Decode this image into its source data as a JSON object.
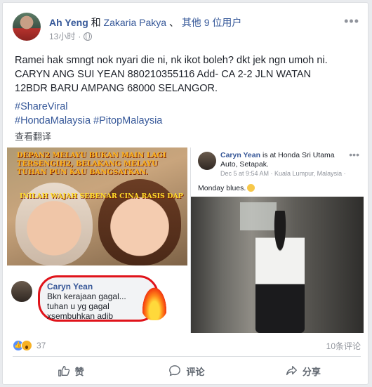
{
  "post": {
    "author": "Ah Yeng",
    "connector": "和",
    "tagged": "Zakaria Pakya",
    "separator": "、",
    "others": "其他 9 位用户",
    "timestamp": "13小时",
    "dot": "·",
    "more_icon": "ellipsis-icon",
    "privacy_icon": "globe-icon",
    "text_line1": "Ramei hak smngt nok nyari die ni, nk ikot boleh? dkt jek ngn umoh ni.",
    "text_line2": "CARYN ANG SUI YEAN 880210355116 Add- CA 2-2 JLN WATAN",
    "text_line3": "12BDR BARU AMPANG 68000 SELANGOR.",
    "hashtag1": "#ShareViral",
    "hashtag2": "#HondaMalaysia #PitopMalaysia",
    "translate": "查看翻译"
  },
  "photo_left": {
    "overlay_top": "DEPAN2 MELAYU BUKAN MAIN LAGI TERSENGIH2, BELAKANG MELAYU TUHAN PUN KAU BANGSATKAN.",
    "overlay_bottom": "INILAH WAJAH SEBENAR CINA RASIS DAP",
    "comment_name": "Caryn Yean",
    "comment_line1": "Bkn kerajaan gagal...",
    "comment_line2": "tuhan u yg gagal",
    "comment_line3": "xsembuhkan adib"
  },
  "photo_right": {
    "name": "Caryn Yean",
    "checkin": "is at Honda Sri Utama Auto, Setapak.",
    "meta": "Dec 5 at 9:54 AM · Kuala Lumpur, Malaysia ·",
    "status": "Monday blues."
  },
  "stats": {
    "reaction_count": "37",
    "comments": "10条评论"
  },
  "actions": {
    "like": "赞",
    "comment": "评论",
    "share": "分享"
  },
  "colors": {
    "link": "#365899",
    "background": "#e9ebee",
    "highlight": "#e0131a"
  }
}
